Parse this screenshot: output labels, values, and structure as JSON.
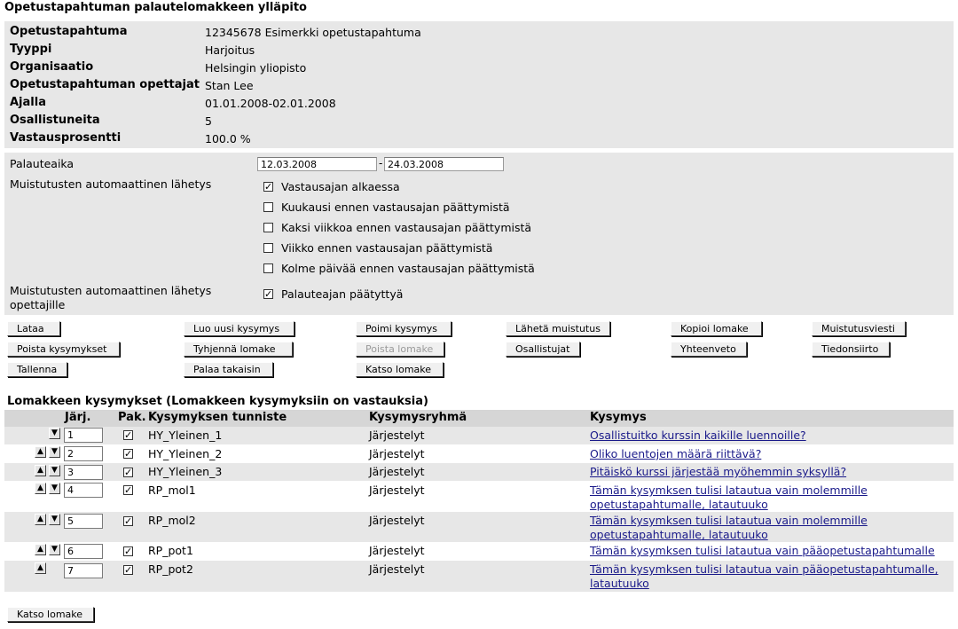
{
  "page_title": "Opetustapahtuman palautelomakkeen ylläpito",
  "info": [
    {
      "label": "Opetustapahtuma",
      "value": "12345678 Esimerkki opetustapahtuma"
    },
    {
      "label": "Tyyppi",
      "value": "Harjoitus"
    },
    {
      "label": "Organisaatio",
      "value": "Helsingin yliopisto"
    },
    {
      "label": "Opetustapahtuman opettajat",
      "value": "Stan Lee"
    },
    {
      "label": "Ajalla",
      "value": "01.01.2008-02.01.2008"
    },
    {
      "label": "Osallistuneita",
      "value": "5"
    },
    {
      "label": "Vastausprosentti",
      "value": "100.0 %"
    }
  ],
  "settings": {
    "palauteaika_label": "Palauteaika",
    "start_date": "12.03.2008",
    "separator": "-",
    "end_date": "24.03.2008",
    "reminder_label": "Muistutusten automaattinen lähetys",
    "reminders": [
      {
        "label": "Vastausajan alkaessa",
        "checked": true
      },
      {
        "label": "Kuukausi ennen vastausajan päättymistä",
        "checked": false
      },
      {
        "label": "Kaksi viikkoa ennen vastausajan päättymistä",
        "checked": false
      },
      {
        "label": "Viikko ennen vastausajan päättymistä",
        "checked": false
      },
      {
        "label": "Kolme päivää ennen vastausajan päättymistä",
        "checked": false
      }
    ],
    "teacher_reminder_label_1": "Muistutusten automaattinen lähetys",
    "teacher_reminder_label_2": "opettajille",
    "teacher_reminder": {
      "label": "Palauteajan päätyttyä",
      "checked": true
    }
  },
  "buttons": {
    "lataa": "Lataa",
    "luo_uusi": "Luo uusi kysymys",
    "poimi": "Poimi kysymys",
    "laheta": "Lähetä muistutus",
    "kopioi": "Kopioi lomake",
    "muistutusviesti": "Muistutusviesti",
    "poista_kysymykset": "Poista kysymykset",
    "tyhjenna": "Tyhjennä lomake",
    "poista_lomake": "Poista lomake",
    "osallistujat": "Osallistujat",
    "yhteenveto": "Yhteenveto",
    "tiedonsiirto": "Tiedonsiirto",
    "tallenna": "Tallenna",
    "palaa": "Palaa takaisin",
    "katso": "Katso lomake",
    "katso_bottom": "Katso lomake"
  },
  "questions_title": "Lomakkeen kysymykset (Lomakkeen kysymyksiin on vastauksia)",
  "table_headers": {
    "jarj": "Järj.",
    "pak": "Pak.",
    "tunniste": "Kysymyksen tunniste",
    "ryhma": "Kysymysryhmä",
    "kysymys": "Kysymys"
  },
  "rows": [
    {
      "order": "1",
      "pak": true,
      "tunniste": "HY_Yleinen_1",
      "ryhma": "Järjestelyt",
      "kysymys": "Osallistuitko kurssin kaikille luennoille?"
    },
    {
      "order": "2",
      "pak": true,
      "tunniste": "HY_Yleinen_2",
      "ryhma": "Järjestelyt",
      "kysymys": "Oliko luentojen määrä riittävä?"
    },
    {
      "order": "3",
      "pak": true,
      "tunniste": "HY_Yleinen_3",
      "ryhma": "Järjestelyt",
      "kysymys": "Pitäiskö kurssi järjestää myöhemmin syksyllä?"
    },
    {
      "order": "4",
      "pak": true,
      "tunniste": "RP_mol1",
      "ryhma": "Järjestelyt",
      "kysymys": "Tämän kysymksen tulisi latautua vain molemmille opetustapahtumalle, latautuuko"
    },
    {
      "order": "5",
      "pak": true,
      "tunniste": "RP_mol2",
      "ryhma": "Järjestelyt",
      "kysymys": "Tämän kysymksen tulisi latautua vain molemmille opetustapahtumalle, latautuuko"
    },
    {
      "order": "6",
      "pak": true,
      "tunniste": "RP_pot1",
      "ryhma": "Järjestelyt",
      "kysymys": "Tämän kysymksen tulisi latautua vain pääopetustapahtumalle"
    },
    {
      "order": "7",
      "pak": true,
      "tunniste": "RP_pot2",
      "ryhma": "Järjestelyt",
      "kysymys": "Tämän kysymksen tulisi latautua vain pääopetustapahtumalle, latautuuko"
    }
  ]
}
